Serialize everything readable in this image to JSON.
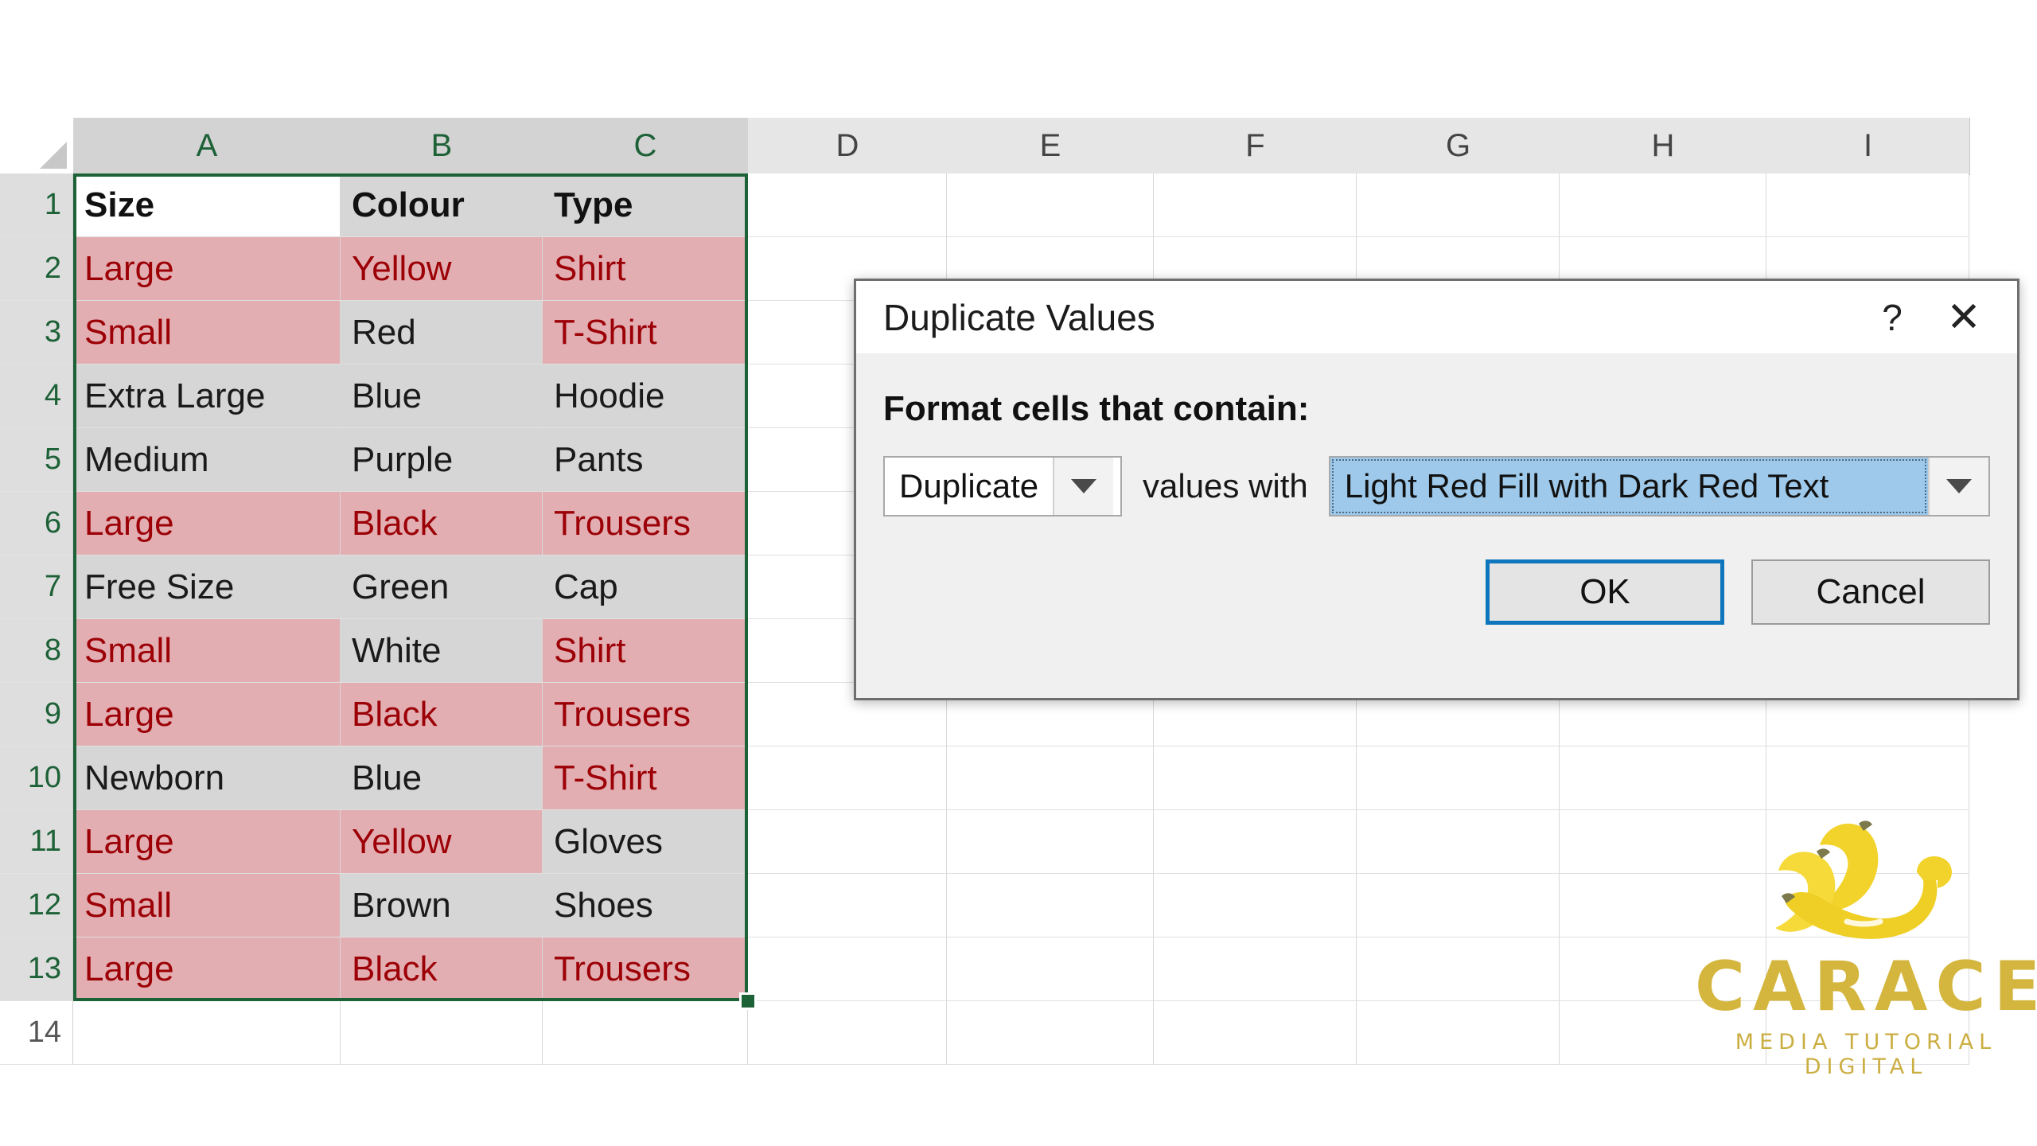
{
  "spreadsheet": {
    "column_headers": [
      "A",
      "B",
      "C",
      "D",
      "E",
      "F",
      "G",
      "H",
      "I"
    ],
    "row_numbers": [
      "1",
      "2",
      "3",
      "4",
      "5",
      "6",
      "7",
      "8",
      "9",
      "10",
      "11",
      "12",
      "13",
      "14"
    ],
    "selected_range": "A1:C13",
    "duplicate_fill_color": "#E2AEB2",
    "duplicate_text_color": "#9C0006",
    "selection_border_color": "#1D6137",
    "rows": [
      {
        "n": "1",
        "a": "Size",
        "b": "Colour",
        "c": "Type",
        "a_dup": false,
        "b_dup": false,
        "c_dup": false,
        "header": true
      },
      {
        "n": "2",
        "a": "Large",
        "b": "Yellow",
        "c": "Shirt",
        "a_dup": true,
        "b_dup": true,
        "c_dup": true
      },
      {
        "n": "3",
        "a": "Small",
        "b": "Red",
        "c": "T-Shirt",
        "a_dup": true,
        "b_dup": false,
        "c_dup": true
      },
      {
        "n": "4",
        "a": "Extra Large",
        "b": "Blue",
        "c": "Hoodie",
        "a_dup": false,
        "b_dup": false,
        "c_dup": false
      },
      {
        "n": "5",
        "a": "Medium",
        "b": "Purple",
        "c": "Pants",
        "a_dup": false,
        "b_dup": false,
        "c_dup": false
      },
      {
        "n": "6",
        "a": "Large",
        "b": "Black",
        "c": "Trousers",
        "a_dup": true,
        "b_dup": true,
        "c_dup": true
      },
      {
        "n": "7",
        "a": "Free Size",
        "b": "Green",
        "c": "Cap",
        "a_dup": false,
        "b_dup": false,
        "c_dup": false
      },
      {
        "n": "8",
        "a": "Small",
        "b": "White",
        "c": "Shirt",
        "a_dup": true,
        "b_dup": false,
        "c_dup": true
      },
      {
        "n": "9",
        "a": "Large",
        "b": "Black",
        "c": "Trousers",
        "a_dup": true,
        "b_dup": true,
        "c_dup": true
      },
      {
        "n": "10",
        "a": "Newborn",
        "b": "Blue",
        "c": "T-Shirt",
        "a_dup": false,
        "b_dup": false,
        "c_dup": true
      },
      {
        "n": "11",
        "a": "Large",
        "b": "Yellow",
        "c": "Gloves",
        "a_dup": true,
        "b_dup": true,
        "c_dup": false
      },
      {
        "n": "12",
        "a": "Small",
        "b": "Brown",
        "c": "Shoes",
        "a_dup": true,
        "b_dup": false,
        "c_dup": false
      },
      {
        "n": "13",
        "a": "Large",
        "b": "Black",
        "c": "Trousers",
        "a_dup": true,
        "b_dup": true,
        "c_dup": true
      },
      {
        "n": "14",
        "a": "",
        "b": "",
        "c": "",
        "a_dup": false,
        "b_dup": false,
        "c_dup": false,
        "outside": true
      }
    ]
  },
  "dialog": {
    "title": "Duplicate Values",
    "help_icon": "?",
    "close_icon": "✕",
    "section_label": "Format cells that contain:",
    "kind_value": "Duplicate",
    "middle_label": "values with",
    "format_value": "Light Red Fill with Dark Red Text",
    "ok_label": "OK",
    "cancel_label": "Cancel",
    "focus_color": "#0F75BC",
    "selection_highlight_color": "#9EC9EA"
  },
  "watermark": {
    "name": "CARACEK",
    "tagline": "MEDIA TUTORIAL DIGITAL",
    "logo_icon": "banana-bunch-icon",
    "color": "#D4B63F"
  }
}
